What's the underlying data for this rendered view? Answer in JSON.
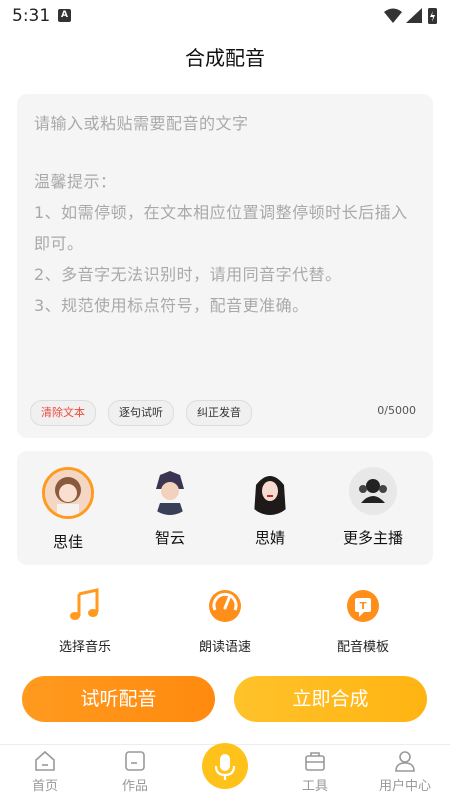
{
  "status": {
    "time": "5:31",
    "notif": "A"
  },
  "page": {
    "title": "合成配音"
  },
  "editor": {
    "placeholder": "请输入或粘贴需要配音的文字",
    "tips_title": "温馨提示：",
    "tips": [
      "1、如需停顿，在文本相应位置调整停顿时长后插入即可。",
      "2、多音字无法识别时，请用同音字代替。",
      "3、规范使用标点符号，配音更准确。"
    ],
    "chips": {
      "clear": "清除文本",
      "sentence": "逐句试听",
      "correct": "纠正发音"
    },
    "counter": "0/5000"
  },
  "anchors": [
    {
      "name": "思佳",
      "selected": true
    },
    {
      "name": "智云",
      "selected": false
    },
    {
      "name": "思婧",
      "selected": false
    },
    {
      "name": "更多主播",
      "selected": false
    }
  ],
  "tools": [
    {
      "label": "选择音乐",
      "icon": "music-note-icon"
    },
    {
      "label": "朗读语速",
      "icon": "speed-gauge-icon"
    },
    {
      "label": "配音模板",
      "icon": "template-icon"
    }
  ],
  "buttons": {
    "preview": "试听配音",
    "synth": "立即合成"
  },
  "tabbar": [
    {
      "label": "首页",
      "icon": "home-icon"
    },
    {
      "label": "作品",
      "icon": "folder-icon"
    },
    {
      "label": "",
      "icon": "mic-icon"
    },
    {
      "label": "工具",
      "icon": "toolbox-icon"
    },
    {
      "label": "用户中心",
      "icon": "user-icon"
    }
  ],
  "colors": {
    "accent": "#ff9a1f",
    "accent2": "#ffc21a",
    "danger": "#e84c3d"
  }
}
